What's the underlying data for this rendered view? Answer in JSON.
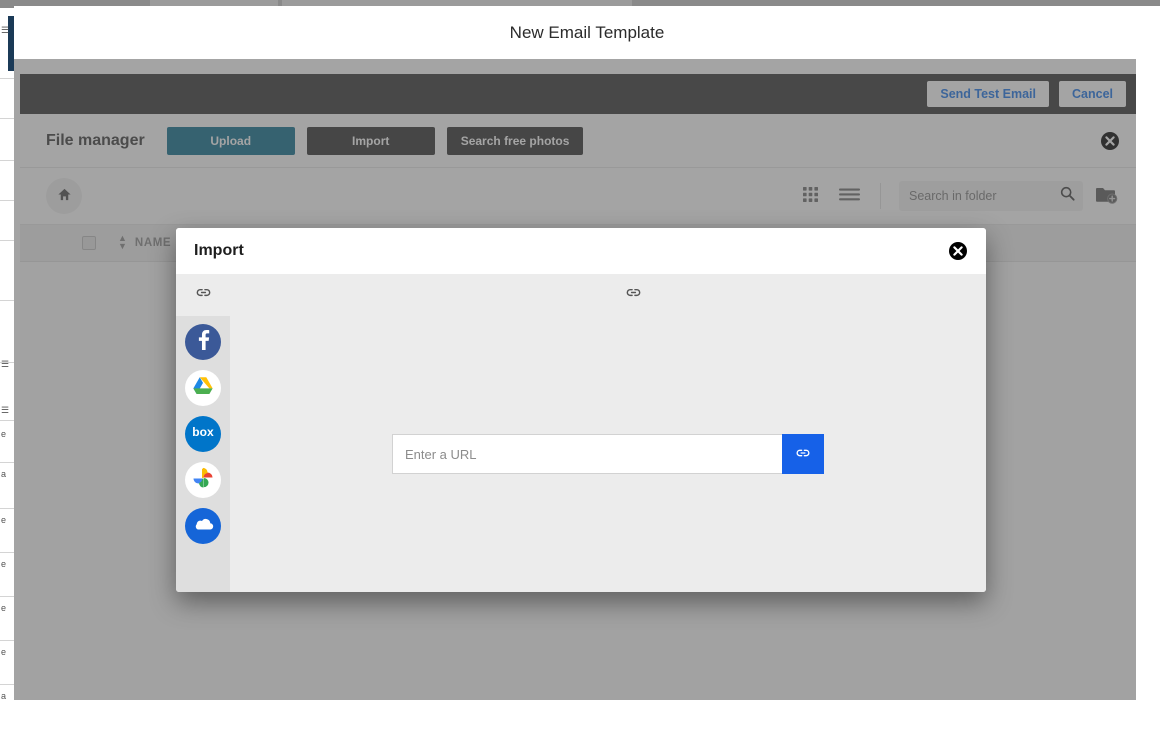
{
  "window": {
    "title": "New Email Template"
  },
  "toolbar": {
    "send_test_label": "Send Test Email",
    "cancel_label": "Cancel"
  },
  "file_manager": {
    "title": "File manager",
    "tabs": [
      {
        "label": "Upload",
        "active": true
      },
      {
        "label": "Import",
        "active": false
      },
      {
        "label": "Search free photos",
        "active": false
      }
    ],
    "close_label": "",
    "home_icon": "home-icon",
    "grid_view_icon": "grid-view-icon",
    "list_view_icon": "list-view-icon",
    "new_folder_icon": "new-folder-icon",
    "search": {
      "placeholder": "Search in folder",
      "value": "",
      "icon": "search-icon"
    },
    "columns": {
      "name": "NAME"
    }
  },
  "import_modal": {
    "title": "Import",
    "close_icon": "close-circle-icon",
    "tabs": [
      {
        "icon": "link-icon",
        "name": "link-tab-sidebar"
      },
      {
        "icon": "link-icon",
        "name": "link-tab-content"
      }
    ],
    "services": [
      {
        "name": "facebook",
        "label": "Facebook",
        "color": "#3b5998"
      },
      {
        "name": "google-drive",
        "label": "Google Drive",
        "color": "#ffffff"
      },
      {
        "name": "box",
        "label": "Box",
        "color": "#0075c9"
      },
      {
        "name": "google-photos",
        "label": "Google Photos",
        "color": "#ffffff"
      },
      {
        "name": "onedrive",
        "label": "OneDrive",
        "color": "#1565d8"
      }
    ],
    "url_field": {
      "placeholder": "Enter a URL",
      "value": "",
      "submit_icon": "link-icon"
    }
  },
  "colors": {
    "accent_teal": "#0d6e8c",
    "toolbar_dark": "#333333",
    "link_blue": "#1a73e8",
    "submit_blue": "#1661e8",
    "modal_bg": "#ececec",
    "sidebar_bg": "#dedede"
  }
}
